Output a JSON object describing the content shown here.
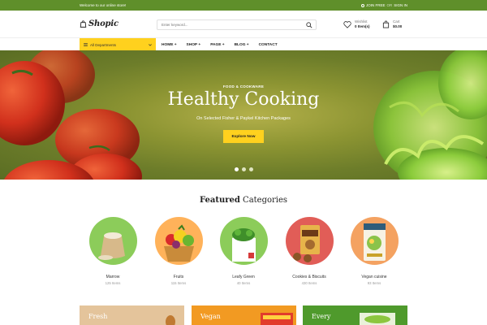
{
  "topbar": {
    "welcome": "Welcome to our online store!",
    "join": "JOIN FREE",
    "or": "OR",
    "signin": "SIGN IN"
  },
  "header": {
    "logo": "Shopic",
    "search_placeholder": "Enter keyword...",
    "wishlist": {
      "label": "Wishlist",
      "value": "0 Item(s)"
    },
    "cart": {
      "label": "Cart",
      "value": "$0.00"
    }
  },
  "nav": {
    "departments": "All Departments",
    "menu": [
      "HOME +",
      "SHOP +",
      "PAGE +",
      "BLOG +",
      "CONTACT"
    ]
  },
  "hero": {
    "eyebrow": "FOOD & COOKWARE",
    "title": "Healthy Cooking",
    "subtitle": "On Selected Fisher & Paykel Kitchen Packages",
    "button": "Explore Now",
    "slides": 3,
    "active_slide": 1
  },
  "featured": {
    "title_bold": "Featured",
    "title_rest": "Categories",
    "categories": [
      {
        "name": "Marrow",
        "count": "125 Items",
        "color": "#8ccc5a"
      },
      {
        "name": "Fruits",
        "count": "115 Items",
        "color": "#ffb25a"
      },
      {
        "name": "Leafy Green",
        "count": "40 Items",
        "color": "#8ccc5a"
      },
      {
        "name": "Cookies & Biscuits",
        "count": "430 Items",
        "color": "#e15d57"
      },
      {
        "name": "Vegan cuisine",
        "count": "93 Items",
        "color": "#f4a261"
      }
    ]
  },
  "promos": [
    {
      "text": "Fresh",
      "color": "#e4c49b"
    },
    {
      "text": "Vegan",
      "color": "#f29a22"
    },
    {
      "text": "Every",
      "color": "#4f9a2c"
    }
  ],
  "colors": {
    "brand_green": "#5f8f2a",
    "accent_yellow": "#ffd11e"
  }
}
